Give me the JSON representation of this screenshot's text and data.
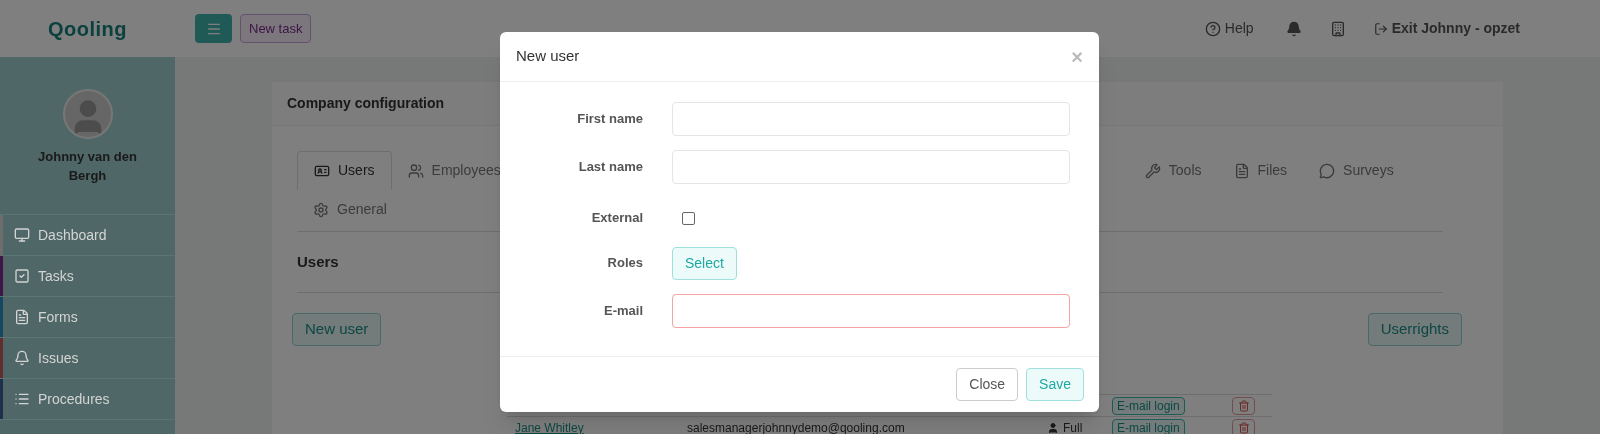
{
  "logo": "Qooling",
  "topbar": {
    "new_task": "New task",
    "help": "Help",
    "exit": "Exit Johnny - opzet"
  },
  "user": {
    "name": "Johnny van den Bergh"
  },
  "sidebar": {
    "items": [
      {
        "label": "Dashboard",
        "color": "#6d6d6d"
      },
      {
        "label": "Tasks",
        "color": "#3e1546"
      },
      {
        "label": "Forms",
        "color": "#154662"
      },
      {
        "label": "Issues",
        "color": "#622d2d"
      },
      {
        "label": "Procedures",
        "color": "#1f304e"
      }
    ]
  },
  "card": {
    "title": "Company configuration",
    "tabs": [
      {
        "label": "Users",
        "selected": true
      },
      {
        "label": "Employees",
        "selected": false
      },
      {
        "label": "Tools",
        "selected": false
      },
      {
        "label": "Files",
        "selected": false
      },
      {
        "label": "Surveys",
        "selected": false
      },
      {
        "label": "General",
        "selected": false
      }
    ],
    "section_title": "Users",
    "new_user": "New user",
    "userrights": "Userrights",
    "rows": [
      {
        "login": "E-mail login"
      },
      {
        "name": "Jane Whitley",
        "email": "salesmanagerjohnnydemo@qooling.com",
        "rights": "Full",
        "login": "E-mail login"
      }
    ]
  },
  "modal": {
    "title": "New user",
    "close_x": "×",
    "fields": [
      {
        "kind": "text",
        "label": "First name",
        "invalid": false
      },
      {
        "kind": "text",
        "label": "Last name",
        "invalid": false
      },
      {
        "kind": "checkbox",
        "label": "External",
        "checked": false
      },
      {
        "kind": "select",
        "label": "Roles",
        "button": "Select"
      },
      {
        "kind": "text",
        "label": "E-mail",
        "invalid": true
      }
    ],
    "buttons": {
      "close": "Close",
      "save": "Save"
    }
  }
}
